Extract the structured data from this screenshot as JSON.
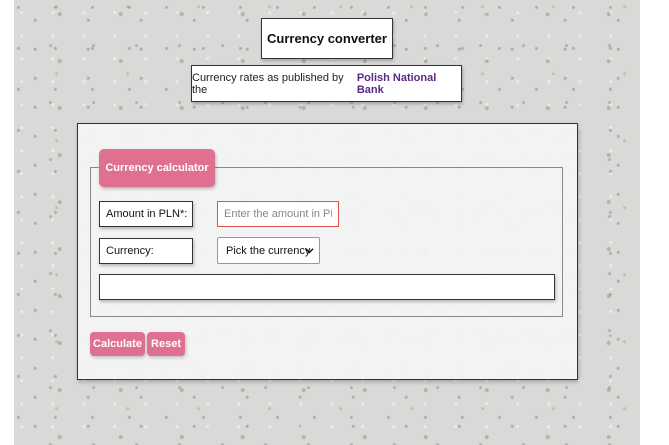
{
  "header": {
    "title": "Currency converter",
    "subtitle_prefix": "Currency rates as published by the",
    "subtitle_link": "Polish National Bank"
  },
  "calculator": {
    "legend": "Currency calculator",
    "amount_label": "Amount in PLN*:",
    "amount_placeholder": "Enter the amount in PLN",
    "amount_value": "",
    "currency_label": "Currency:",
    "currency_selected": "Pick the currency",
    "result": ""
  },
  "buttons": {
    "calculate": "Calculate",
    "reset": "Reset"
  },
  "colors": {
    "accent": "#e07090",
    "link": "#5a2a82",
    "input_error_border": "#d9534f"
  },
  "icons": {
    "select_arrow": "chevron-down-icon"
  }
}
